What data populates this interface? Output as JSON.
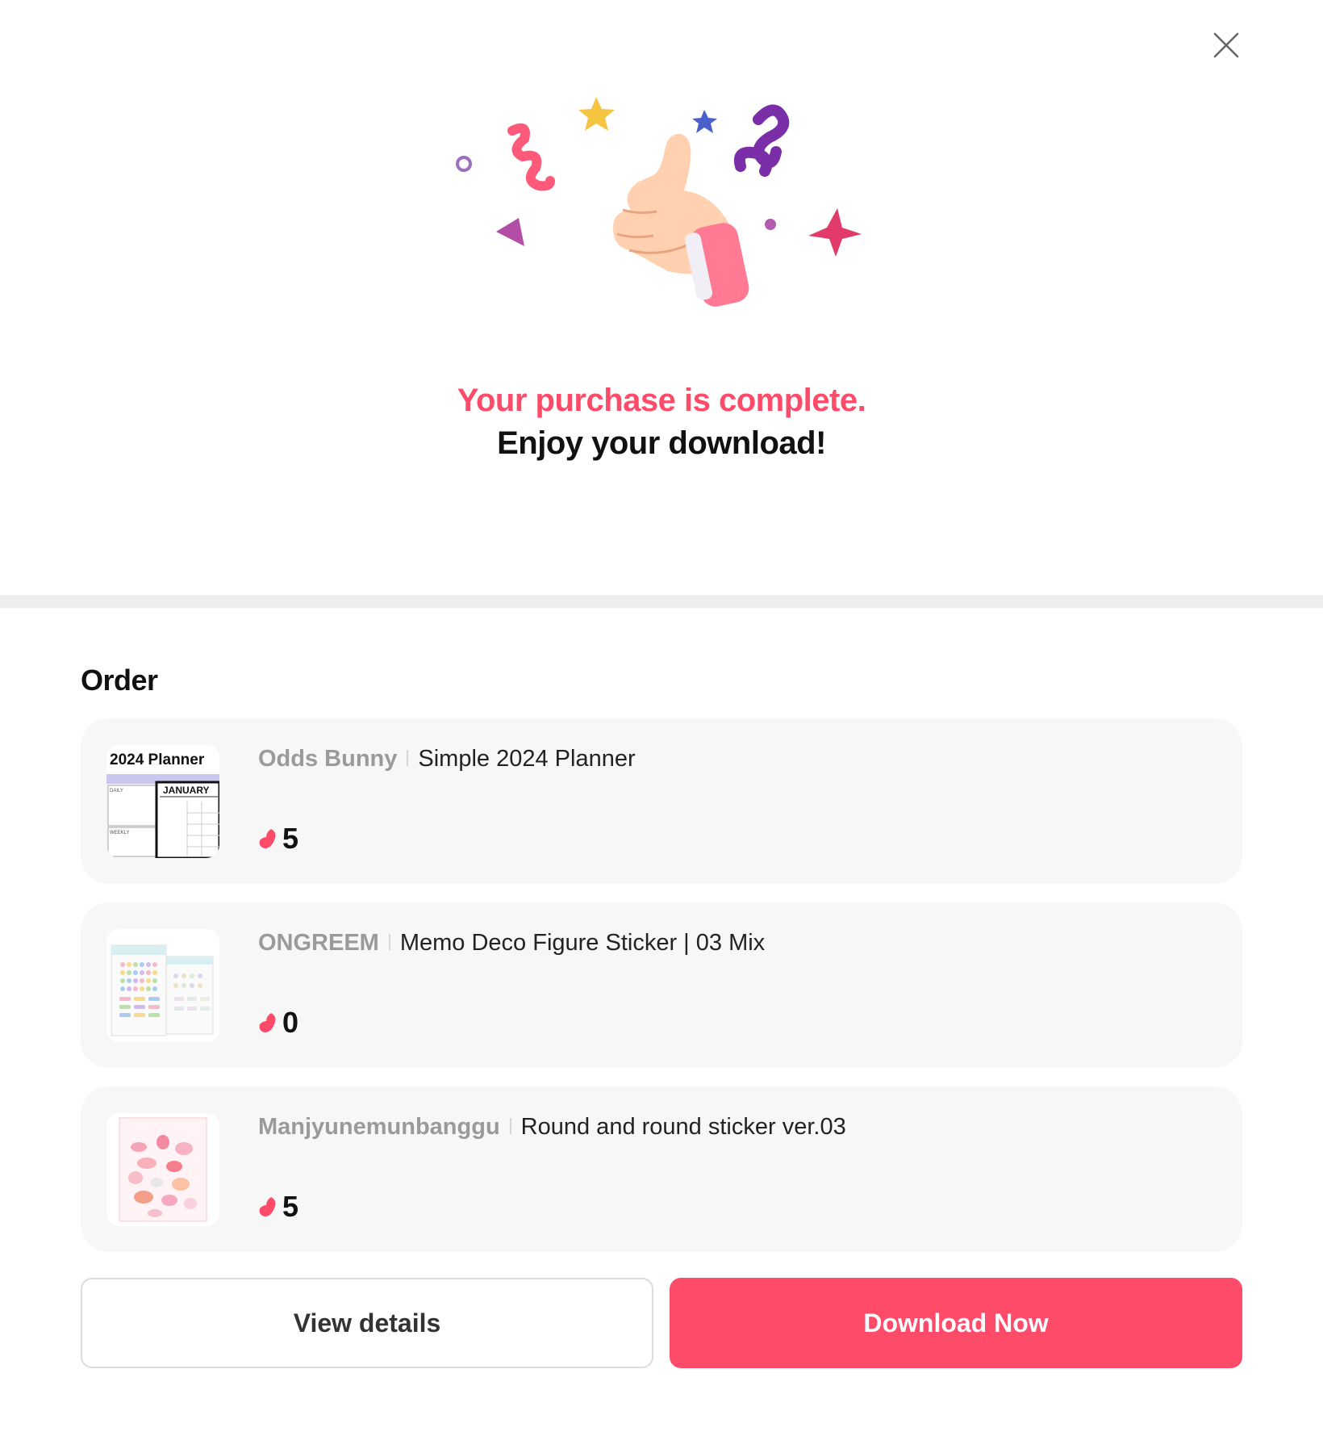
{
  "colors": {
    "accent": "#ff4b6a",
    "divider": "#eeeeee",
    "card": "#f7f7f7"
  },
  "header": {
    "close_icon": "close-icon"
  },
  "hero": {
    "illustration": "thumbs-up-confetti"
  },
  "message": {
    "line1": "Your purchase is complete.",
    "line2": "Enjoy your download!"
  },
  "order": {
    "title": "Order",
    "items": [
      {
        "seller": "Odds Bunny",
        "title": "Simple 2024 Planner",
        "price": "5",
        "price_icon": "jelly-icon",
        "thumb_text": {
          "heading": "2024 Planner",
          "label1": "JANUARY",
          "label2": "DAILY",
          "label3": "WEEKLY"
        }
      },
      {
        "seller": "ONGREEM",
        "title": "Memo Deco Figure Sticker | 03 Mix",
        "price": "0",
        "price_icon": "jelly-icon"
      },
      {
        "seller": "Manjyunemunbanggu",
        "title": "Round and round sticker ver.03",
        "price": "5",
        "price_icon": "jelly-icon"
      }
    ]
  },
  "actions": {
    "details_label": "View details",
    "download_label": "Download Now"
  }
}
